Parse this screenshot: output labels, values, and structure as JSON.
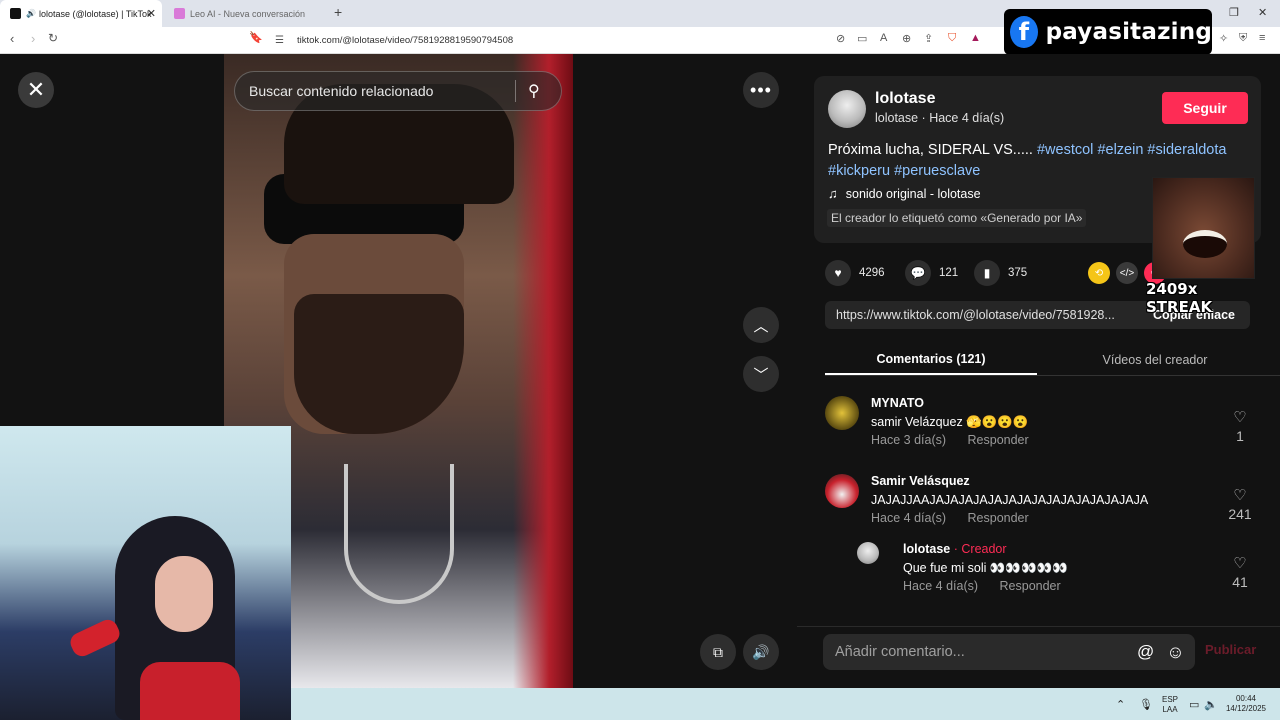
{
  "browser": {
    "tabs": [
      {
        "title": "lolotase (@lolotase) | TikTok",
        "active": true
      },
      {
        "title": "Leo AI - Nueva conversación",
        "active": false
      }
    ],
    "new_tab": "+",
    "url": "tiktok.com/@lolotase/video/7581928819590794508"
  },
  "overlay": {
    "fb_logo": "f",
    "fb_name": "payasitazing",
    "streak": "2409x STREAK"
  },
  "video": {
    "search_placeholder": "Buscar contenido relacionado"
  },
  "post": {
    "author": "lolotase",
    "author_sub": "lolotase · Hace 4 día(s)",
    "follow": "Seguir",
    "caption_text": "Próxima lucha, SIDERAL VS..... ",
    "hashtags": [
      "#westcol",
      "#elzein",
      "#sideraldota",
      "#kickperu",
      "#peruesclave"
    ],
    "sound": "sonido original - lolotase",
    "ai_label": "El creador lo etiquetó como «Generado por IA»",
    "likes": "4296",
    "comments": "121",
    "saves": "375",
    "link": "https://www.tiktok.com/@lolotase/video/7581928...",
    "copy_link": "Copiar enlace"
  },
  "panel_tabs": {
    "comments": "Comentarios (121)",
    "creator_videos": "Vídeos del creador"
  },
  "comments": [
    {
      "user": "MYNATO",
      "text": "samir Velázquez 🫣😮😮😮",
      "time": "Hace 3 día(s)",
      "reply": "Responder",
      "likes": "1"
    },
    {
      "user": "Samir Velásquez",
      "text": "JAJAJJAAJAJAJAJAJAJAJAJAJAJAJAJAJAJAJA",
      "time": "Hace 4 día(s)",
      "reply": "Responder",
      "likes": "241"
    },
    {
      "user": "lolotase",
      "badge": "Creador",
      "text": "Que fue mi soli 👀👀👀👀👀",
      "time": "Hace 4 día(s)",
      "reply": "Responder",
      "likes": "41"
    }
  ],
  "comment_bar": {
    "placeholder": "Añadir comentario...",
    "post": "Publicar"
  },
  "taskbar": {
    "lang_top": "ESP",
    "lang_bottom": "LAA",
    "time": "00:44",
    "date": "14/12/2025"
  }
}
